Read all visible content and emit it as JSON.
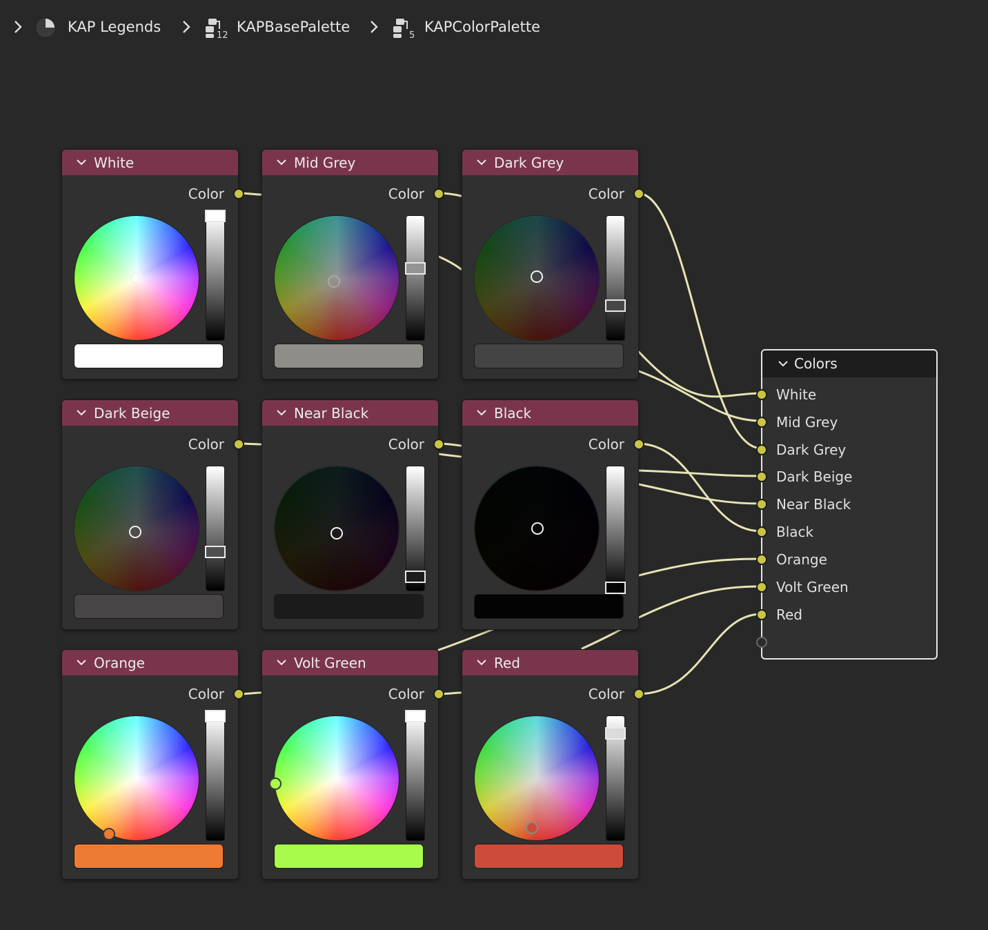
{
  "breadcrumb": {
    "items": [
      {
        "label": "KAP Legends",
        "icon": "material-icon"
      },
      {
        "label": "KAPBasePalette",
        "icon": "node-group-icon",
        "badge": "12"
      },
      {
        "label": "KAPColorPalette",
        "icon": "node-group-icon",
        "badge": "5"
      }
    ]
  },
  "colors": {
    "header": "#7a354c",
    "wire": "#e7e3b4",
    "socket": "#c9c545"
  },
  "nodes": [
    {
      "title": "White",
      "output_label": "Color",
      "swatch": "#ffffff",
      "value": 1.0
    },
    {
      "title": "Mid Grey",
      "output_label": "Color",
      "swatch": "#8e8d87",
      "value": 0.58
    },
    {
      "title": "Dark Grey",
      "output_label": "Color",
      "swatch": "#444444",
      "value": 0.28
    },
    {
      "title": "Dark Beige",
      "output_label": "Color",
      "swatch": "#474545",
      "value": 0.31
    },
    {
      "title": "Near Black",
      "output_label": "Color",
      "swatch": "#1c1b1b",
      "value": 0.11
    },
    {
      "title": "Black",
      "output_label": "Color",
      "swatch": "#030303",
      "value": 0.02
    },
    {
      "title": "Orange",
      "output_label": "Color",
      "swatch": "#ee7b33",
      "value": 1.0
    },
    {
      "title": "Volt Green",
      "output_label": "Color",
      "swatch": "#a9fb4b",
      "value": 1.0
    },
    {
      "title": "Red",
      "output_label": "Color",
      "swatch": "#cd4b3a",
      "value": 0.86
    }
  ],
  "group_output": {
    "title": "Colors",
    "inputs": [
      "White",
      "Mid Grey",
      "Dark Grey",
      "Dark Beige",
      "Near Black",
      "Black",
      "Orange",
      "Volt Green",
      "Red"
    ]
  }
}
